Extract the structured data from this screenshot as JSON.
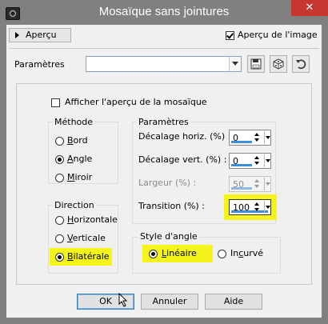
{
  "window": {
    "title": "Mosaïque sans jointures",
    "close_label": "✕"
  },
  "preview": {
    "button_label": "Aperçu",
    "image_preview_label": "Aperçu de l'image",
    "image_preview_checked": true
  },
  "presets": {
    "label": "Paramètres",
    "value": ""
  },
  "mosaic_preview": {
    "label": "Afficher l'aperçu de la mosaïque",
    "checked": false
  },
  "method": {
    "title": "Méthode",
    "options": [
      {
        "label": "Bord",
        "selected": false
      },
      {
        "label": "Angle",
        "selected": true
      },
      {
        "label": "Miroir",
        "selected": false
      }
    ]
  },
  "direction": {
    "title": "Direction",
    "options": [
      {
        "label": "Horizontale",
        "selected": false
      },
      {
        "label": "Verticale",
        "selected": false
      },
      {
        "label": "Bilatérale",
        "selected": true
      }
    ]
  },
  "parameters": {
    "title": "Paramètres",
    "fields": [
      {
        "label": "Décalage horiz. (%) :",
        "value": "0",
        "enabled": true
      },
      {
        "label": "Décalage vert. (%) :",
        "value": "0",
        "enabled": true
      },
      {
        "label": "Largeur (%) :",
        "value": "50",
        "enabled": false
      },
      {
        "label": "Transition (%) :",
        "value": "100",
        "enabled": true
      }
    ]
  },
  "angle_style": {
    "title": "Style d'angle",
    "options": [
      {
        "label": "Linéaire",
        "selected": true
      },
      {
        "label": "Incurvé",
        "selected": false
      }
    ]
  },
  "buttons": {
    "ok": "OK",
    "cancel": "Annuler",
    "help": "Aide"
  },
  "colors": {
    "highlight": "#f4f41a",
    "close": "#c7372f",
    "spin_bar": "#3b8fd9"
  }
}
